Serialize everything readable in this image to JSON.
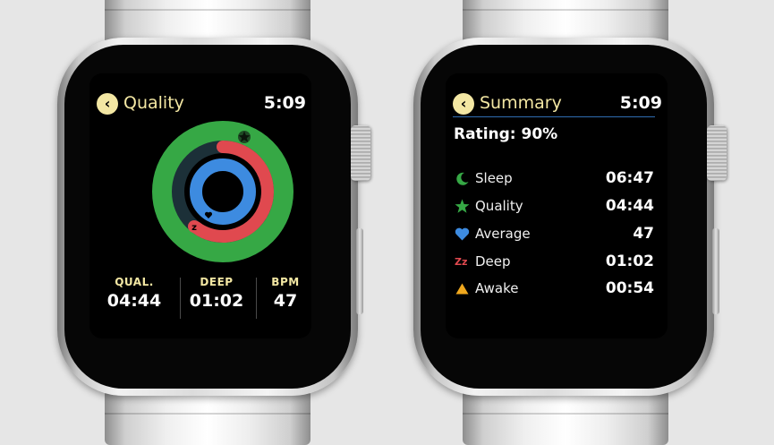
{
  "colors": {
    "background": "#e6e6e6",
    "accent": "#f3e7a3",
    "green": "#36a845",
    "blue": "#3d8be0",
    "red": "#e0494f",
    "orange": "#f0a81e"
  },
  "quality_screen": {
    "back_icon": "chevron-left-icon",
    "title": "Quality",
    "time": "5:09",
    "rings": {
      "outer_color": "green",
      "middle_color": "red",
      "inner_color": "blue",
      "outer_icon": "star-icon",
      "middle_icon": "zz-icon",
      "inner_icon": "heart-icon"
    },
    "stats": [
      {
        "label": "QUAL.",
        "value": "04:44"
      },
      {
        "label": "DEEP",
        "value": "01:02"
      },
      {
        "label": "BPM",
        "value": "47"
      }
    ]
  },
  "summary_screen": {
    "back_icon": "chevron-left-icon",
    "title": "Summary",
    "time": "5:09",
    "rating": "Rating: 90%",
    "rows": [
      {
        "icon": "moon-icon",
        "label": "Sleep",
        "value": "06:47"
      },
      {
        "icon": "star-icon",
        "label": "Quality",
        "value": "04:44"
      },
      {
        "icon": "heart-icon",
        "label": "Average",
        "value": "47"
      },
      {
        "icon": "zz-icon",
        "icon_text": "Zz",
        "label": "Deep",
        "value": "01:02"
      },
      {
        "icon": "triangle-icon",
        "label": "Awake",
        "value": "00:54"
      }
    ]
  }
}
